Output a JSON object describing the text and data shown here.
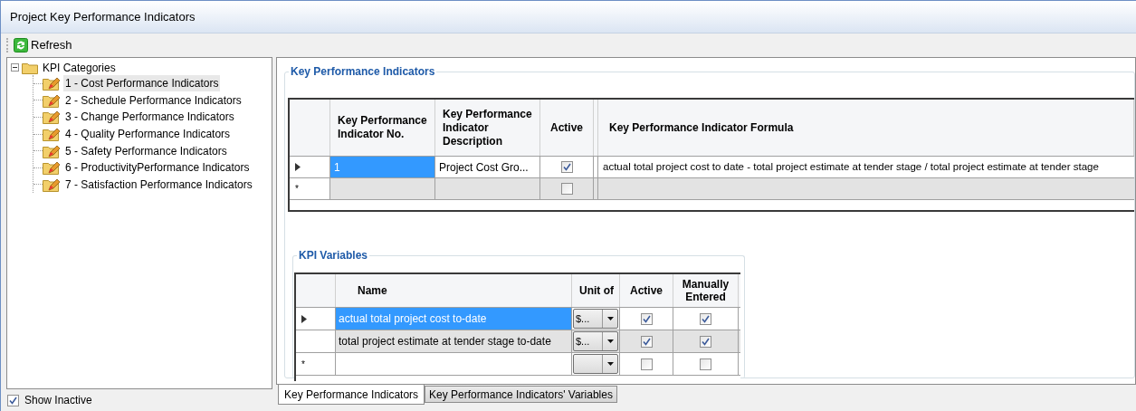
{
  "window": {
    "title": "Project Key Performance Indicators"
  },
  "toolbar": {
    "refresh": "Refresh"
  },
  "tree": {
    "label": "KPI Categories",
    "expanded": true,
    "children": [
      {
        "label": "1 - Cost Performance Indicators",
        "selected": true
      },
      {
        "label": "2 - Schedule Performance Indicators",
        "selected": false
      },
      {
        "label": "3 - Change Performance Indicators",
        "selected": false
      },
      {
        "label": "4 - Quality Performance Indicators",
        "selected": false
      },
      {
        "label": "5 - Safety Performance Indicators",
        "selected": false
      },
      {
        "label": "6 - ProductivityPerformance Indicators",
        "selected": false
      },
      {
        "label": "7 - Satisfaction Performance Indicators",
        "selected": false
      }
    ]
  },
  "show_inactive": {
    "label": "Show Inactive",
    "checked": true
  },
  "kpi_grid": {
    "title": "Key Performance Indicators",
    "columns": [
      "Key Performance Indicator No.",
      "Key Performance Indicator Description",
      "Active",
      "Key Performance Indicator Formula"
    ],
    "rows": [
      {
        "kind": "current",
        "number": "1",
        "description": "Project Cost Gro...",
        "active": true,
        "formula": "actual total project cost to date - total project estimate at tender stage / total project estimate at tender stage"
      },
      {
        "kind": "new",
        "marker": "*",
        "active": false
      }
    ]
  },
  "variables_grid": {
    "title": "KPI Variables",
    "columns": [
      "Name",
      "Unit of",
      "Active",
      "Manually Entered"
    ],
    "rows": [
      {
        "kind": "current",
        "name": "actual total project cost to-date",
        "unit": "$...",
        "active": true,
        "manually_entered": true
      },
      {
        "kind": "data",
        "name": "total project estimate at tender stage to-date",
        "unit": "$...",
        "active": true,
        "manually_entered": true
      },
      {
        "kind": "new",
        "marker": "*",
        "active": false,
        "manually_entered": false
      }
    ]
  },
  "tabs": [
    {
      "label": "Key Performance Indicators",
      "selected": true
    },
    {
      "label": "Key Performance Indicators' Variables",
      "selected": false
    }
  ]
}
